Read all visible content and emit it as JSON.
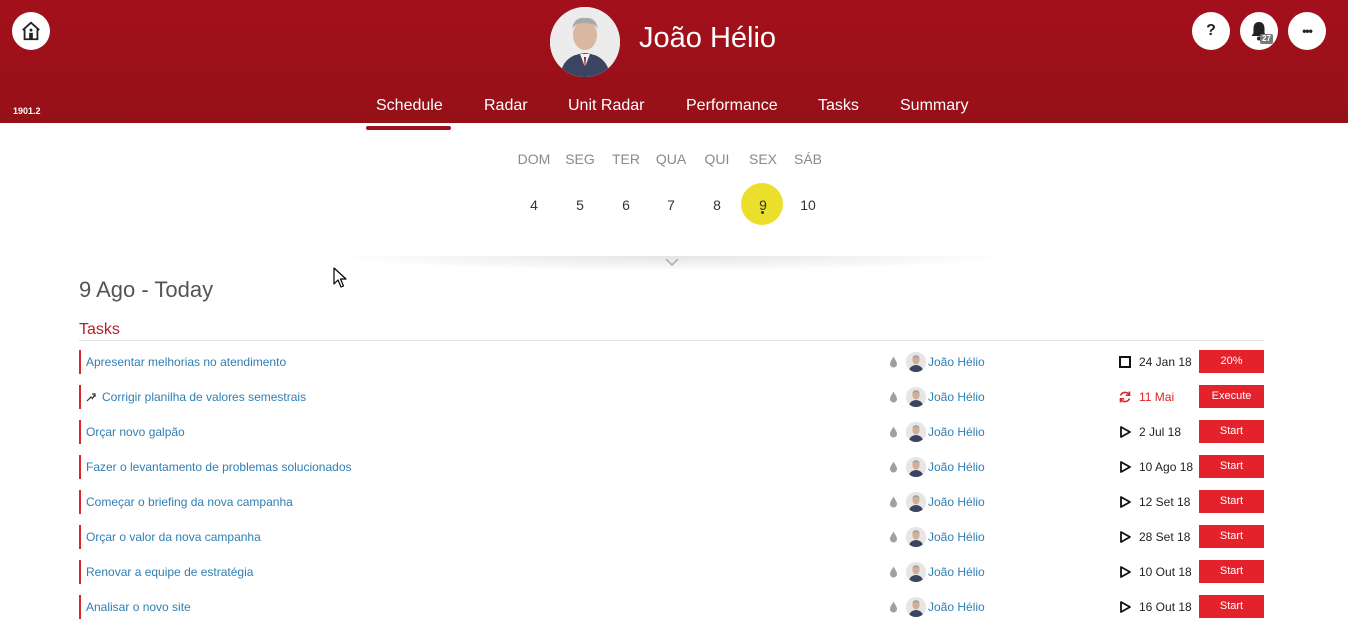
{
  "header": {
    "version": "1901.2",
    "user_name": "João Hélio",
    "notifications_count": "27",
    "help_label": "?",
    "more_label": "•••"
  },
  "nav": {
    "tabs": [
      {
        "label": "Schedule",
        "active": true
      },
      {
        "label": "Radar"
      },
      {
        "label": "Unit Radar"
      },
      {
        "label": "Performance"
      },
      {
        "label": "Tasks"
      },
      {
        "label": "Summary"
      }
    ]
  },
  "calendar": {
    "weekdays": [
      "DOM",
      "SEG",
      "TER",
      "QUA",
      "QUI",
      "SEX",
      "SÁB"
    ],
    "days": [
      "4",
      "5",
      "6",
      "7",
      "8",
      "9",
      "10"
    ],
    "today": "9",
    "highlight_color": "#ecdf2b"
  },
  "main": {
    "date_title": "9 Ago - Today",
    "section_title": "Tasks"
  },
  "tasks": [
    {
      "name": "Apresentar melhorias no atendimento",
      "assignee": "João Hélio",
      "status_icon": "square-icon",
      "due": "24 Jan 18",
      "action": "20%"
    },
    {
      "name": "Corrigir planilha de valores semestrais",
      "assignee": "João Hélio",
      "status_icon": "refresh-icon",
      "due": "11 Mai",
      "action": "Execute",
      "linked": true
    },
    {
      "name": "Orçar novo galpão",
      "assignee": "João Hélio",
      "status_icon": "play-icon",
      "due": "2 Jul 18",
      "action": "Start"
    },
    {
      "name": "Fazer o levantamento de problemas solucionados",
      "assignee": "João Hélio",
      "status_icon": "play-icon",
      "due": "10 Ago 18",
      "action": "Start"
    },
    {
      "name": "Começar o briefing da nova campanha",
      "assignee": "João Hélio",
      "status_icon": "play-icon",
      "due": "12 Set 18",
      "action": "Start"
    },
    {
      "name": "Orçar o valor da nova campanha",
      "assignee": "João Hélio",
      "status_icon": "play-icon",
      "due": "28 Set 18",
      "action": "Start"
    },
    {
      "name": "Renovar a equipe de estratégia",
      "assignee": "João Hélio",
      "status_icon": "play-icon",
      "due": "10 Out 18",
      "action": "Start"
    },
    {
      "name": "Analisar o novo site",
      "assignee": "João Hélio",
      "status_icon": "play-icon",
      "due": "16 Out 18",
      "action": "Start"
    }
  ],
  "colors": {
    "header_red": "#9b1019",
    "accent_red": "#e4222c",
    "link_blue": "#2f7fb3"
  }
}
